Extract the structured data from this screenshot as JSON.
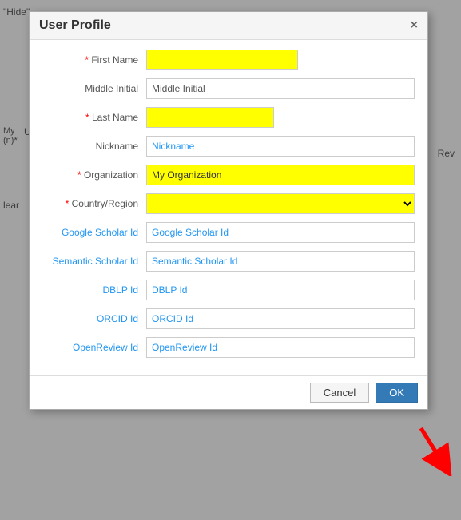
{
  "background": {
    "hide_text": "\"Hide\"",
    "user_label": "U",
    "rev_label": "Rev",
    "clear_label": "lear",
    "my_label": "My\n(n)*"
  },
  "modal": {
    "title": "User Profile",
    "close_label": "×",
    "fields": {
      "first_name_label": "First Name",
      "middle_initial_label": "Middle Initial",
      "middle_initial_placeholder": "Middle Initial",
      "last_name_label": "Last Name",
      "nickname_label": "Nickname",
      "nickname_placeholder": "Nickname",
      "organization_label": "Organization",
      "organization_value": "My Organization",
      "country_label": "Country/Region",
      "google_scholar_label": "Google Scholar Id",
      "google_scholar_placeholder": "Google Scholar Id",
      "semantic_scholar_label": "Semantic Scholar Id",
      "semantic_scholar_placeholder": "Semantic Scholar Id",
      "dblp_label": "DBLP Id",
      "dblp_placeholder": "DBLP Id",
      "orcid_label": "ORCID Id",
      "orcid_placeholder": "ORCID Id",
      "openreview_label": "OpenReview Id",
      "openreview_placeholder": "OpenReview Id"
    },
    "footer": {
      "cancel_label": "Cancel",
      "ok_label": "OK"
    }
  }
}
